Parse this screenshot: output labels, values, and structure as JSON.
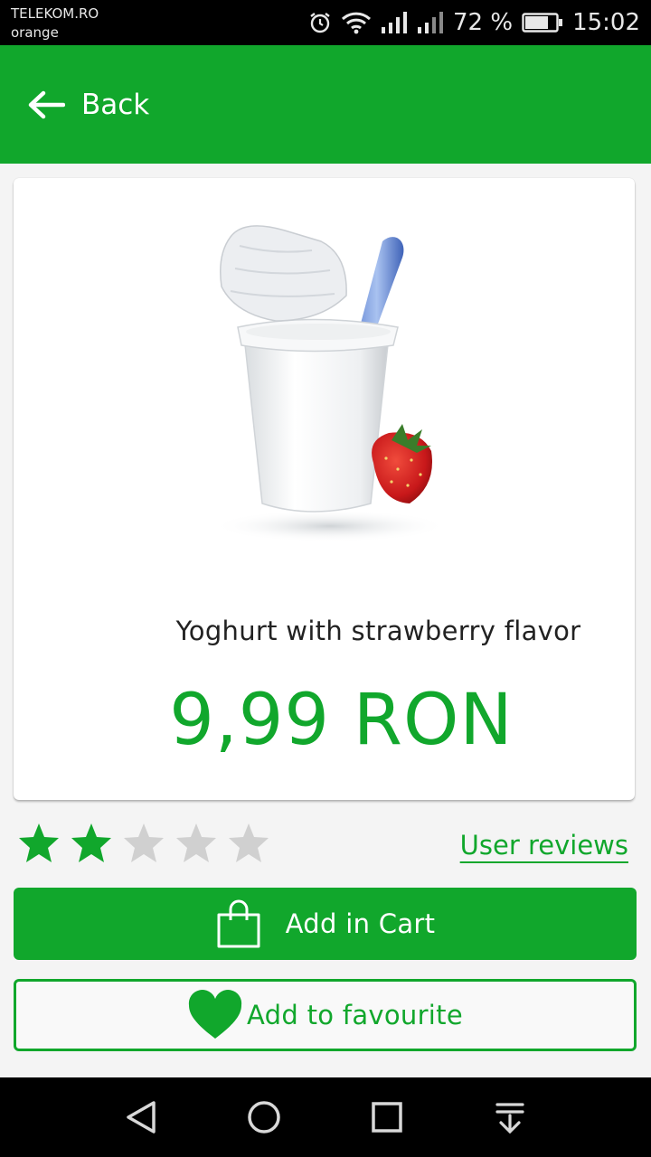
{
  "status_bar": {
    "carrier_1": "TELEKOM.RO",
    "carrier_2": "orange",
    "battery": "72 %",
    "time": "15:02"
  },
  "header": {
    "back_label": "Back",
    "background": "#11a72c"
  },
  "product": {
    "name": "Yoghurt with strawberry flavor",
    "price": "9,99 RON"
  },
  "rating": {
    "value": 2,
    "max": 5,
    "reviews_link": "User reviews"
  },
  "actions": {
    "cart_label": "Add in Cart",
    "favourite_label": "Add to favourite"
  },
  "icons": {
    "back": "arrow-left-icon",
    "cart": "shopping-bag-icon",
    "favourite": "heart-icon"
  }
}
